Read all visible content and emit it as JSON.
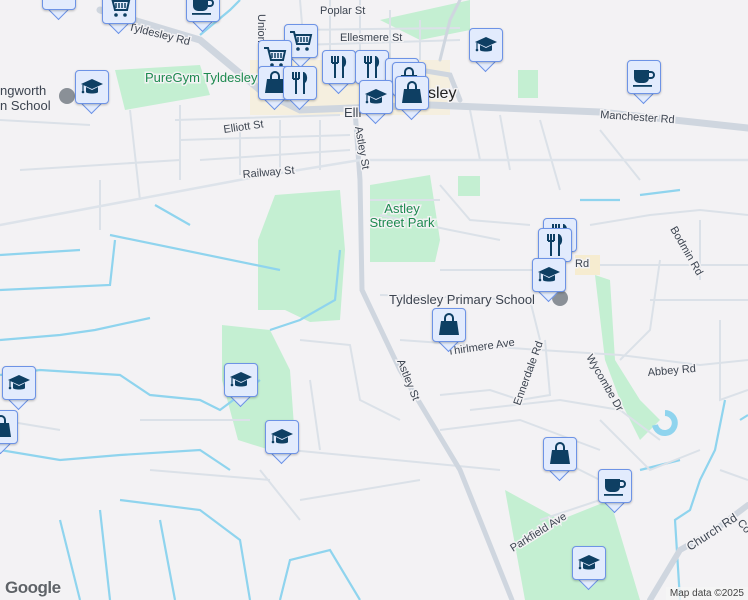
{
  "map": {
    "streets": {
      "poplar": "Poplar St",
      "tyldesley_rd": "Tyldesley Rd",
      "ellesmere": "Ellesmere St",
      "manchester": "Manchester Rd",
      "elliott": "Elliott St",
      "railway": "Railway St",
      "astley_north": "Astley St",
      "astley_south": "Astley St",
      "elliott_east": "Elli",
      "union": "Union St",
      "bodmin": "Bodmin Rd",
      "thirlmere": "Thirlmere Ave",
      "ennerdale": "Ennerdale Rd",
      "wycombe": "Wycombe Dr",
      "abbey": "Abbey Rd",
      "parkfield": "Parkfield Ave",
      "church": "Church Rd",
      "church_co": "Co",
      "rd_fragment": "Rd"
    },
    "places": {
      "puregym": "PureGym Tyldesley",
      "school_west_1": "ngworth",
      "school_west_2": "n School",
      "astley_park_1": "Astley",
      "astley_park_2": "Street Park",
      "primary_school": "Tyldesley Primary School",
      "town": "sley"
    },
    "markers": [
      {
        "type": "school",
        "icon": "graduation-cap-icon"
      },
      {
        "type": "shopping-cart",
        "icon": "shopping-cart-icon"
      },
      {
        "type": "cafe",
        "icon": "coffee-cup-icon"
      },
      {
        "type": "school",
        "icon": "graduation-cap-icon"
      },
      {
        "type": "shopping-cart",
        "icon": "shopping-cart-icon"
      },
      {
        "type": "shopping-cart",
        "icon": "shopping-cart-icon"
      },
      {
        "type": "restaurant",
        "icon": "fork-knife-icon"
      },
      {
        "type": "restaurant",
        "icon": "fork-knife-icon"
      },
      {
        "type": "restaurant",
        "icon": "fork-knife-icon"
      },
      {
        "type": "shop",
        "icon": "shopping-bag-icon"
      },
      {
        "type": "shop",
        "icon": "shopping-bag-icon"
      },
      {
        "type": "restaurant",
        "icon": "fork-knife-icon"
      },
      {
        "type": "school",
        "icon": "graduation-cap-icon"
      },
      {
        "type": "shop",
        "icon": "shopping-bag-icon"
      },
      {
        "type": "school",
        "icon": "graduation-cap-icon"
      },
      {
        "type": "cafe",
        "icon": "coffee-cup-icon"
      },
      {
        "type": "restaurant",
        "icon": "fork-knife-icon"
      },
      {
        "type": "restaurant",
        "icon": "fork-knife-icon"
      },
      {
        "type": "school",
        "icon": "graduation-cap-icon"
      },
      {
        "type": "shop",
        "icon": "shopping-bag-icon"
      },
      {
        "type": "school",
        "icon": "graduation-cap-icon"
      },
      {
        "type": "shop",
        "icon": "shopping-bag-icon"
      },
      {
        "type": "school",
        "icon": "graduation-cap-icon"
      },
      {
        "type": "school",
        "icon": "graduation-cap-icon"
      },
      {
        "type": "shop",
        "icon": "shopping-bag-icon"
      },
      {
        "type": "cafe",
        "icon": "coffee-cup-icon"
      },
      {
        "type": "school",
        "icon": "graduation-cap-icon"
      }
    ],
    "logo": "Google",
    "attribution": "Map data ©2025",
    "colors": {
      "marker_fill": "#e2ebfd",
      "marker_border": "#6d93e6",
      "icon": "#0e3f63",
      "park": "#c4efd2",
      "water": "#8fd4ee"
    }
  }
}
